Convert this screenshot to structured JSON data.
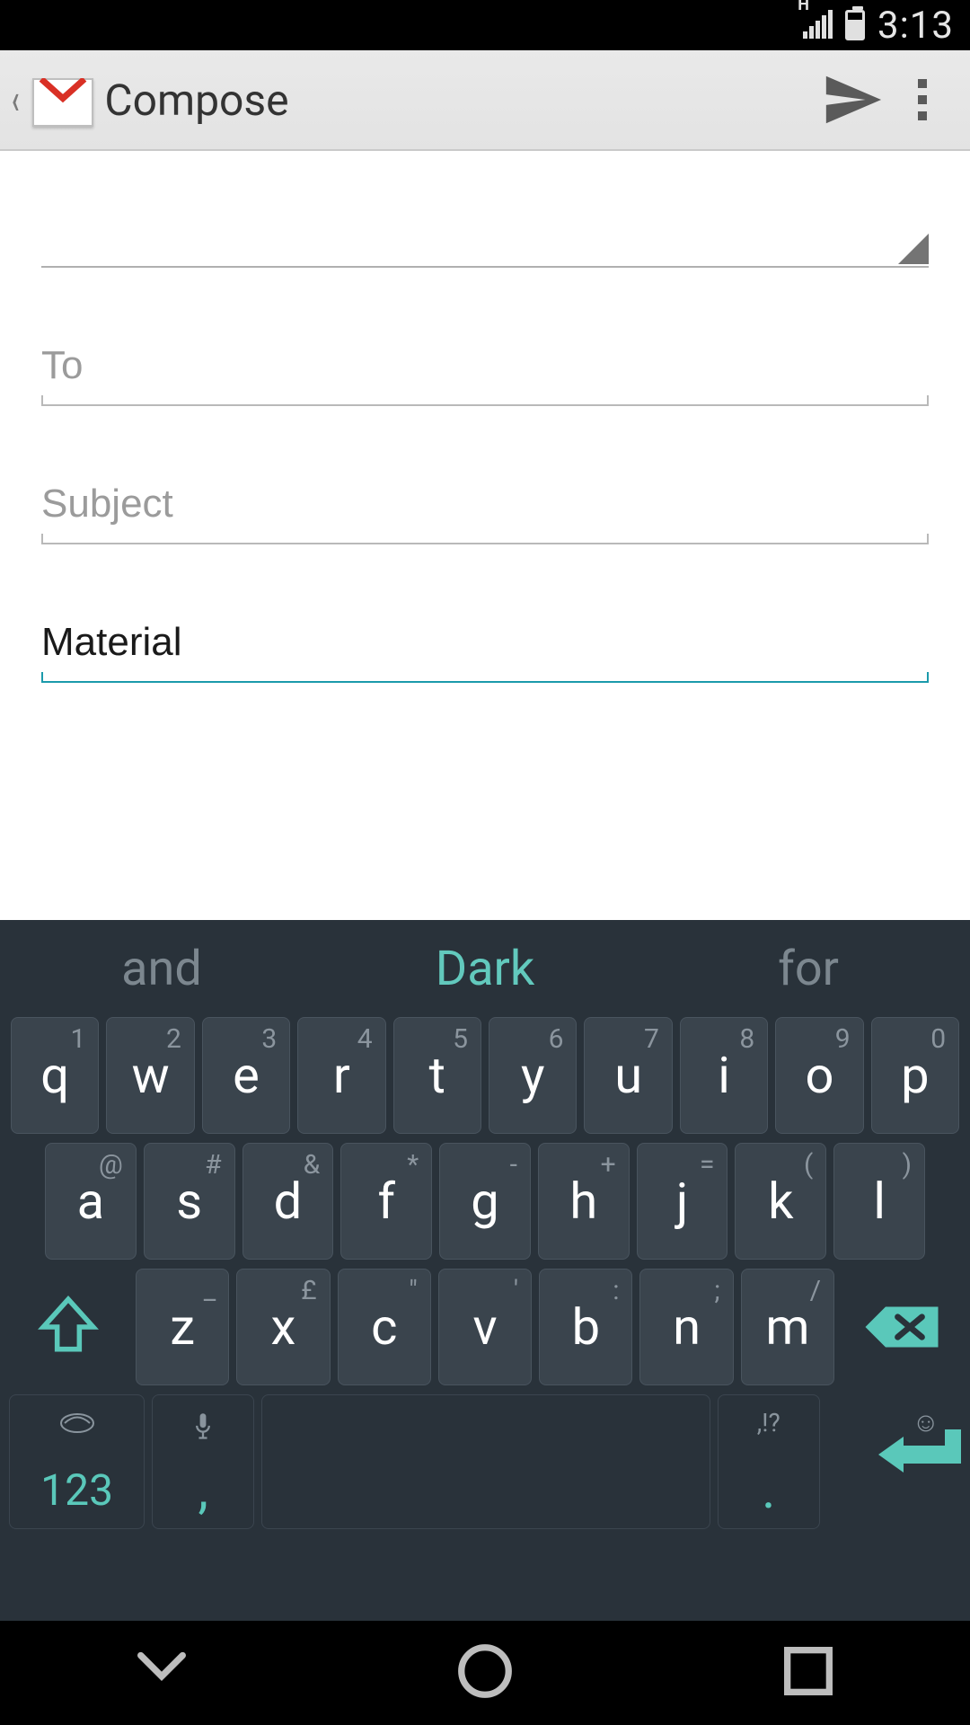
{
  "status_bar": {
    "time": "3:13",
    "network_type": "H"
  },
  "action_bar": {
    "title": "Compose",
    "back_icon": "back-caret-icon",
    "app_icon": "gmail-icon",
    "send_icon": "send-icon",
    "overflow_icon": "overflow-menu-icon"
  },
  "compose": {
    "from_value": "",
    "to_placeholder": "To",
    "to_value": "",
    "subject_placeholder": "Subject",
    "subject_value": "",
    "body_value": "Material"
  },
  "keyboard": {
    "suggestions": {
      "left": "and",
      "middle": "Dark",
      "right": "for"
    },
    "row1": [
      {
        "main": "q",
        "alt": "1"
      },
      {
        "main": "w",
        "alt": "2"
      },
      {
        "main": "e",
        "alt": "3"
      },
      {
        "main": "r",
        "alt": "4"
      },
      {
        "main": "t",
        "alt": "5"
      },
      {
        "main": "y",
        "alt": "6"
      },
      {
        "main": "u",
        "alt": "7"
      },
      {
        "main": "i",
        "alt": "8"
      },
      {
        "main": "o",
        "alt": "9"
      },
      {
        "main": "p",
        "alt": "0"
      }
    ],
    "row2": [
      {
        "main": "a",
        "alt": "@"
      },
      {
        "main": "s",
        "alt": "#"
      },
      {
        "main": "d",
        "alt": "&"
      },
      {
        "main": "f",
        "alt": "*"
      },
      {
        "main": "g",
        "alt": "-"
      },
      {
        "main": "h",
        "alt": "+"
      },
      {
        "main": "j",
        "alt": "="
      },
      {
        "main": "k",
        "alt": "("
      },
      {
        "main": "l",
        "alt": ")"
      }
    ],
    "row3": [
      {
        "main": "z",
        "alt": "_"
      },
      {
        "main": "x",
        "alt": "£"
      },
      {
        "main": "c",
        "alt": "\""
      },
      {
        "main": "v",
        "alt": "'"
      },
      {
        "main": "b",
        "alt": ":"
      },
      {
        "main": "n",
        "alt": ";"
      },
      {
        "main": "m",
        "alt": "/"
      }
    ],
    "numkey": "123",
    "comma": ",",
    "dot": ".",
    "dot_alt": ",!?",
    "shift_icon": "shift-icon",
    "backspace_icon": "backspace-icon",
    "swype_icon": "swype-icon",
    "mic_icon": "microphone-icon",
    "emoji_icon": "emoji-icon",
    "enter_icon": "enter-icon"
  },
  "nav": {
    "back_icon": "nav-back-icon",
    "home_icon": "nav-home-icon",
    "recent_icon": "nav-recent-icon"
  },
  "colors": {
    "accent": "#5ac8ba",
    "focus_underline": "#1b9aab"
  }
}
